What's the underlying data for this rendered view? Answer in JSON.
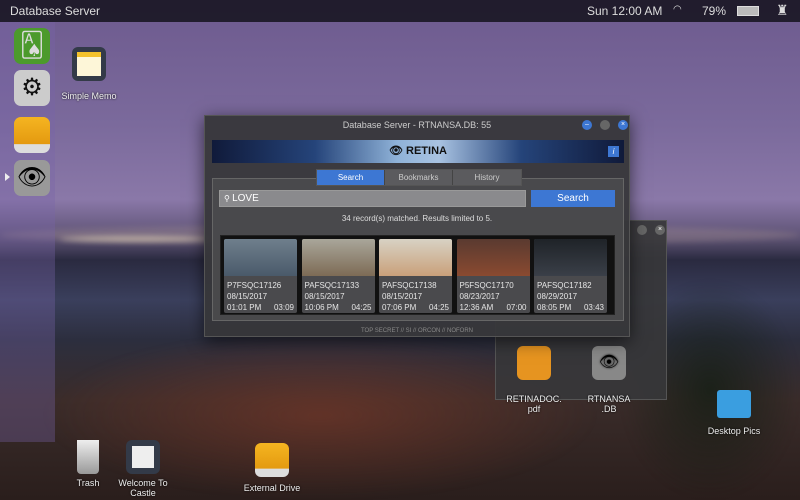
{
  "topbar": {
    "app_name": "Database Server",
    "clock": "Sun 12:00 AM",
    "battery": "79%",
    "icons": [
      "wifi-icon",
      "battery-icon",
      "castle-icon"
    ]
  },
  "dock": {
    "items": [
      "solitaire",
      "settings",
      "external-drive",
      "retina"
    ]
  },
  "desktop": {
    "icons": [
      {
        "label": "Simple Memo"
      },
      {
        "label": "Trash"
      },
      {
        "label": "Welcome To Castle"
      },
      {
        "label": "External Drive"
      },
      {
        "label": "Desktop Pics"
      }
    ]
  },
  "window": {
    "title": "Database Server - RTNANSA.DB: 55",
    "banner": "RETINA",
    "info": "i",
    "tabs": [
      {
        "label": "Search",
        "active": true
      },
      {
        "label": "Bookmarks"
      },
      {
        "label": "History"
      }
    ],
    "search": {
      "value": "LOVE",
      "button": "Search"
    },
    "status": "34 record(s) matched. Results limited to 5.",
    "results": [
      {
        "id": "P7FSQC17126",
        "date": "08/15/2017",
        "time": "01:01 PM",
        "duration": "03:09"
      },
      {
        "id": "PAFSQC17133",
        "date": "08/15/2017",
        "time": "10:06 PM",
        "duration": "04:25"
      },
      {
        "id": "PAFSQC17138",
        "date": "08/15/2017",
        "time": "07:06 PM",
        "duration": "04:25"
      },
      {
        "id": "P5FSQC17170",
        "date": "08/23/2017",
        "time": "12:36 AM",
        "duration": "07:00"
      },
      {
        "id": "PAFSQC17182",
        "date": "08/29/2017",
        "time": "08:05 PM",
        "duration": "03:43"
      }
    ],
    "footer": "TOP SECRET // SI // ORCON // NOFORN"
  },
  "folder_window": {
    "files": [
      {
        "label": "RETINADOC.\npdf"
      },
      {
        "label": "RTNANSA\n.DB"
      }
    ]
  },
  "colors": {
    "accent": "#3d77d3"
  }
}
